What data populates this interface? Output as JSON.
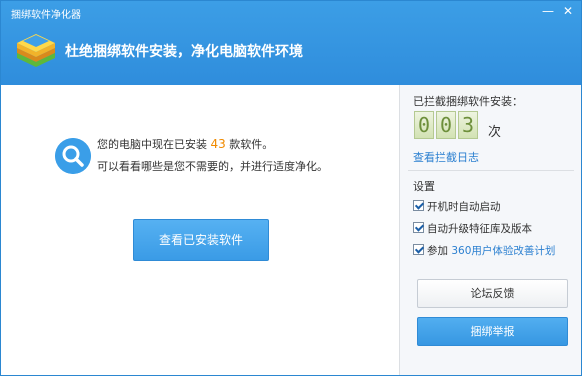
{
  "window": {
    "title": "捆绑软件净化器",
    "min_icon": "minimize-icon",
    "close_icon": "close-icon",
    "min_glyph": "—",
    "close_glyph": "✕"
  },
  "header": {
    "logo_icon": "layers-logo-icon",
    "slogan": "杜绝捆绑软件安装，净化电脑软件环境"
  },
  "main": {
    "search_icon": "search-icon",
    "line1_prefix": "您的电脑中现在已安装",
    "installed_count": "43",
    "line1_suffix": "款软件。",
    "line2": "可以看看哪些是您不需要的，并进行适度净化。",
    "view_button": "查看已安装软件"
  },
  "sidebar": {
    "blocked_title": "已拦截捆绑软件安装：",
    "digits": [
      "0",
      "0",
      "3"
    ],
    "times_label": "次",
    "log_link": "查看拦截日志",
    "settings_title": "设置",
    "options": [
      {
        "label": "开机时自动启动",
        "checked": true
      },
      {
        "label": "自动升级特征库及版本",
        "checked": true
      },
      {
        "label_prefix": "参加",
        "label_link": "360用户体验改善计划",
        "checked": true
      }
    ],
    "feedback_button": "论坛反馈",
    "report_button": "捆绑举报"
  },
  "colors": {
    "header_blue": "#2f8ddc",
    "accent_blue": "#3a9be6",
    "count_orange": "#f08a00",
    "link_blue": "#2a7fd0",
    "digit_green": "#6d8f3b"
  }
}
